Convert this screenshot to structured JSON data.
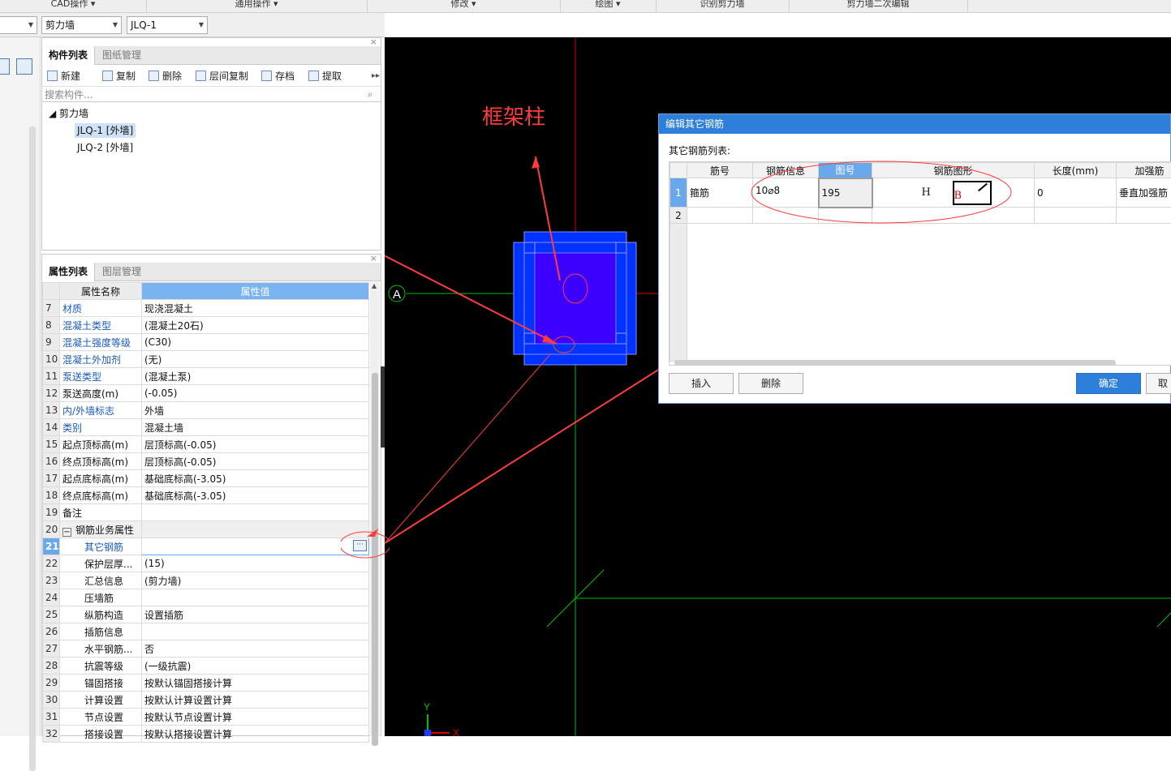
{
  "ribbon": {
    "groups": [
      "CAD操作",
      "通用操作",
      "修改",
      "绘图",
      "识别剪力墙",
      "剪力墙二次编辑"
    ]
  },
  "toolbar": {
    "type_select": "剪力墙",
    "component_select": "JLQ-1"
  },
  "component_panel": {
    "tabs": [
      "构件列表",
      "图纸管理"
    ],
    "buttons": [
      "新建",
      "复制",
      "删除",
      "层间复制",
      "存档",
      "提取"
    ],
    "search_placeholder": "搜索构件...",
    "tree_root": "剪力墙",
    "items": [
      "JLQ-1 [外墙]",
      "JLQ-2 [外墙]"
    ]
  },
  "property_panel": {
    "tabs": [
      "属性列表",
      "图层管理"
    ],
    "col_name": "属性名称",
    "col_value": "属性值",
    "rows": [
      {
        "n": "7",
        "name": "材质",
        "value": "现浇混凝土",
        "link": true
      },
      {
        "n": "8",
        "name": "混凝土类型",
        "value": "(混凝土20石)",
        "link": true
      },
      {
        "n": "9",
        "name": "混凝土强度等级",
        "value": "(C30)",
        "link": true
      },
      {
        "n": "10",
        "name": "混凝土外加剂",
        "value": "(无)",
        "link": true
      },
      {
        "n": "11",
        "name": "泵送类型",
        "value": "(混凝土泵)",
        "link": true
      },
      {
        "n": "12",
        "name": "泵送高度(m)",
        "value": "(-0.05)",
        "link": false
      },
      {
        "n": "13",
        "name": "内/外墙标志",
        "value": "外墙",
        "link": true
      },
      {
        "n": "14",
        "name": "类别",
        "value": "混凝土墙",
        "link": true
      },
      {
        "n": "15",
        "name": "起点顶标高(m)",
        "value": "层顶标高(-0.05)",
        "link": false
      },
      {
        "n": "16",
        "name": "终点顶标高(m)",
        "value": "层顶标高(-0.05)",
        "link": false
      },
      {
        "n": "17",
        "name": "起点底标高(m)",
        "value": "基础底标高(-3.05)",
        "link": false
      },
      {
        "n": "18",
        "name": "终点底标高(m)",
        "value": "基础底标高(-3.05)",
        "link": false
      },
      {
        "n": "19",
        "name": "备注",
        "value": "",
        "link": false
      },
      {
        "n": "20",
        "name": "钢筋业务属性",
        "value": "",
        "link": false
      },
      {
        "n": "21",
        "name": "其它钢筋",
        "value": "",
        "link": true
      },
      {
        "n": "22",
        "name": "保护层厚...",
        "value": "(15)",
        "link": false
      },
      {
        "n": "23",
        "name": "汇总信息",
        "value": "(剪力墙)",
        "link": false
      },
      {
        "n": "24",
        "name": "压墙筋",
        "value": "",
        "link": false
      },
      {
        "n": "25",
        "name": "纵筋构造",
        "value": "设置插筋",
        "link": false
      },
      {
        "n": "26",
        "name": "插筋信息",
        "value": "",
        "link": false
      },
      {
        "n": "27",
        "name": "水平钢筋...",
        "value": "否",
        "link": false
      },
      {
        "n": "28",
        "name": "抗震等级",
        "value": "(一级抗震)",
        "link": false
      },
      {
        "n": "29",
        "name": "锚固搭接",
        "value": "按默认锚固搭接计算",
        "link": false
      },
      {
        "n": "30",
        "name": "计算设置",
        "value": "按默认计算设置计算",
        "link": false
      },
      {
        "n": "31",
        "name": "节点设置",
        "value": "按默认节点设置计算",
        "link": false
      },
      {
        "n": "32",
        "name": "搭接设置",
        "value": "按默认搭接设置计算",
        "link": false
      }
    ]
  },
  "canvas": {
    "annotation": "框架柱",
    "axis_label": "A",
    "ucs_y": "Y",
    "ucs_x": "X"
  },
  "dialog": {
    "title": "编辑其它钢筋",
    "list_label": "其它钢筋列表:",
    "columns": [
      "筋号",
      "钢筋信息",
      "图号",
      "钢筋图形",
      "长度(mm)",
      "加强筋"
    ],
    "rows": [
      {
        "n": "1",
        "name": "箍筋",
        "info": "10⌀8",
        "code": "195",
        "shape_h": "H",
        "shape_b": "B",
        "length": "0",
        "extra": "垂直加强筋"
      },
      {
        "n": "2",
        "name": "",
        "info": "",
        "code": "",
        "shape_h": "",
        "shape_b": "",
        "length": "",
        "extra": ""
      }
    ],
    "insert_label": "插入",
    "delete_label": "删除",
    "ok_label": "确定",
    "cancel_label": "取"
  },
  "colors": {
    "accent": "#2e7fd9",
    "annotation": "#ff3b3b",
    "column_fill": "#0033ff",
    "column_core": "#3c00ff",
    "grid_red": "#ff0000",
    "grid_green": "#00c000"
  }
}
